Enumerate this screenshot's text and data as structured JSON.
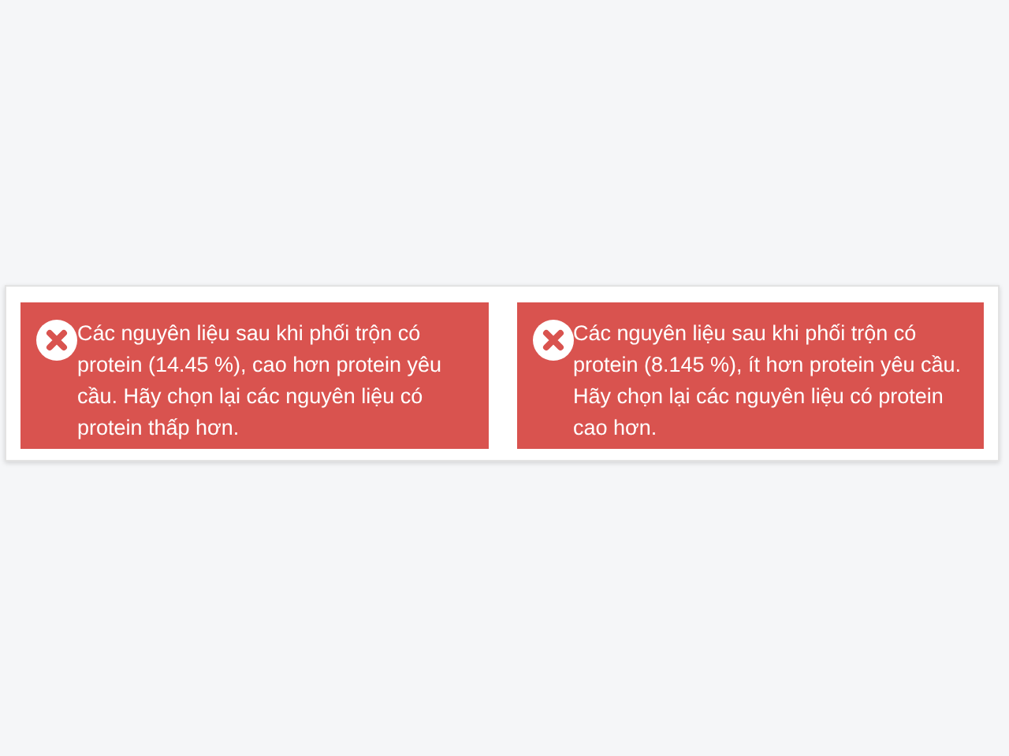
{
  "alerts": [
    {
      "kind": "error",
      "message": "Các nguyên liệu sau khi phối trộn có protein (14.45 %), cao hơn protein yêu cầu. Hãy chọn lại các nguyên liệu có protein thấp hơn."
    },
    {
      "kind": "error",
      "message": "Các nguyên liệu sau khi phối trộn có protein (8.145 %), ít hơn protein yêu cầu. Hãy chọn lại các nguyên liệu có protein cao hơn."
    }
  ]
}
